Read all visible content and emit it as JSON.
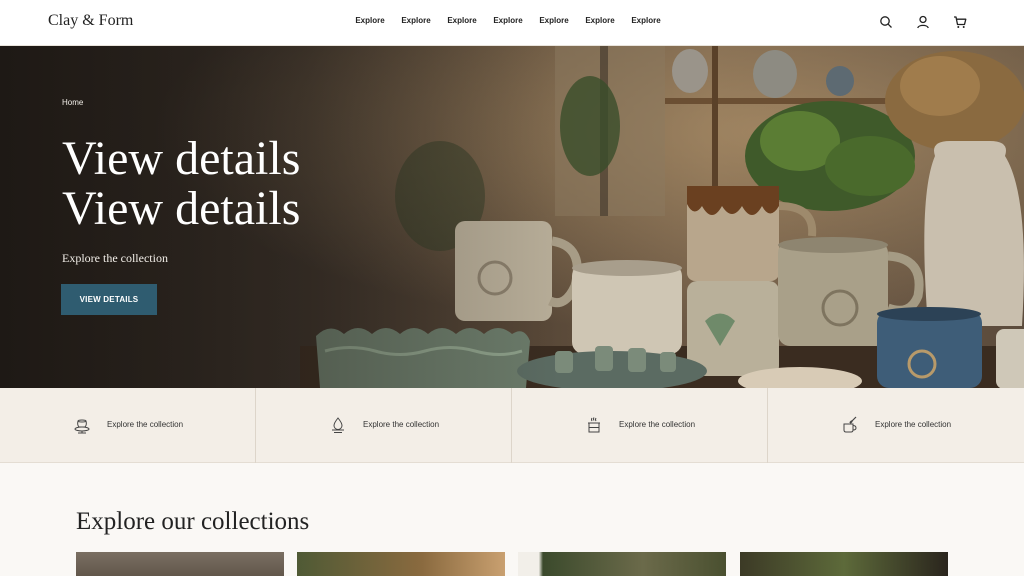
{
  "header": {
    "logo": "Clay & Form",
    "nav": [
      "Explore",
      "Explore",
      "Explore",
      "Explore",
      "Explore",
      "Explore",
      "Explore"
    ],
    "icons": [
      "search-icon",
      "account-icon",
      "cart-icon"
    ]
  },
  "hero": {
    "breadcrumb": "Home",
    "title_line1": "View details",
    "title_line2": "View details",
    "subtitle": "Explore the collection",
    "button_label": "VIEW DETAILS",
    "button_color": "#2f5c70"
  },
  "features": [
    {
      "icon": "pottery-wheel-icon",
      "label": "Explore the collection"
    },
    {
      "icon": "glaze-drop-icon",
      "label": "Explore the collection"
    },
    {
      "icon": "kiln-icon",
      "label": "Explore the collection"
    },
    {
      "icon": "cup-brush-icon",
      "label": "Explore the collection"
    }
  ],
  "collections": {
    "title": "Explore our collections"
  }
}
